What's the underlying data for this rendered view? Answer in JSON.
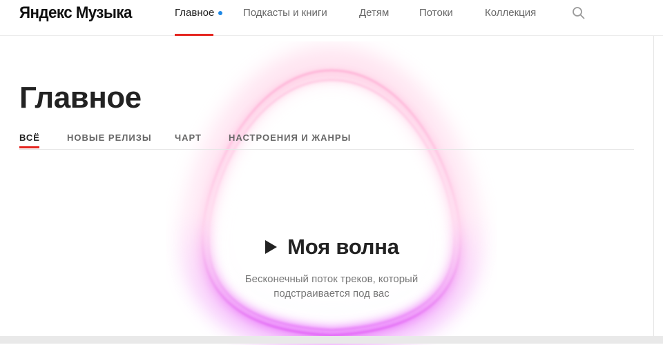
{
  "header": {
    "logo": "Яндекс Музыка",
    "nav": [
      {
        "label": "Главное"
      },
      {
        "label": "Подкасты и книги"
      },
      {
        "label": "Детям"
      },
      {
        "label": "Потоки"
      },
      {
        "label": "Коллекция"
      }
    ],
    "search_icon": "search-icon",
    "accent_color": "#e52620",
    "dot_color": "#1e88e5"
  },
  "page": {
    "title": "Главное",
    "tabs": [
      {
        "label": "ВСЁ"
      },
      {
        "label": "НОВЫЕ РЕЛИЗЫ"
      },
      {
        "label": "ЧАРТ"
      },
      {
        "label": "НАСТРОЕНИЯ И ЖАНРЫ"
      }
    ]
  },
  "my_wave": {
    "title": "Моя волна",
    "description_line1": "Бесконечный поток треков, который",
    "description_line2": "подстраивается под вас",
    "play_icon": "play-icon",
    "glow_colors": [
      "#ff9ecb",
      "#e040fb"
    ]
  }
}
